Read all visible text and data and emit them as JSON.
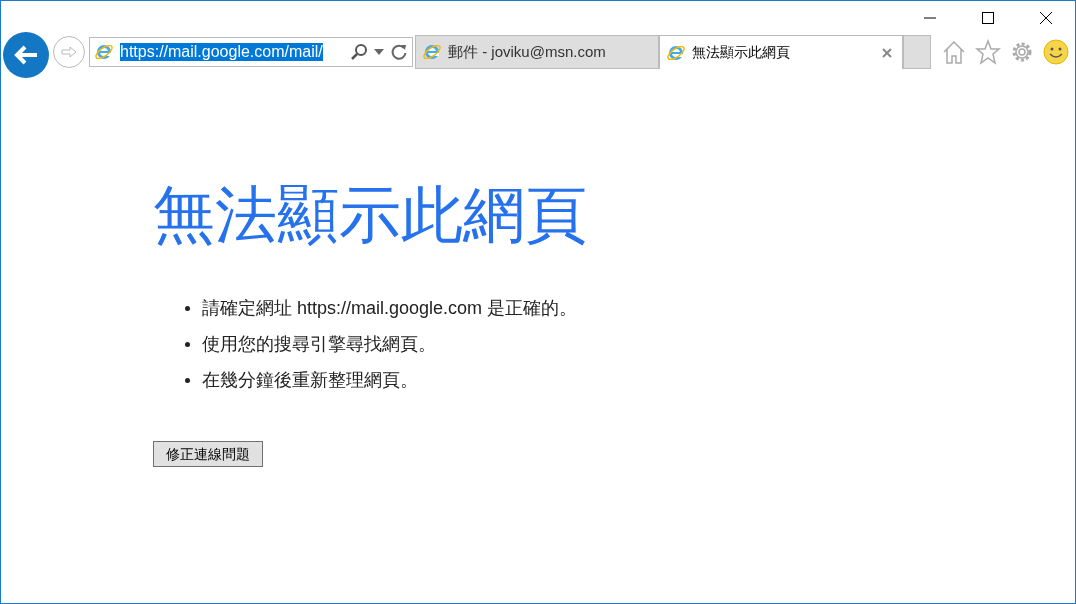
{
  "address_bar": {
    "value": "https://mail.google.com/mail/"
  },
  "tabs": [
    {
      "label": "郵件 - joviku@msn.com",
      "selected": false
    },
    {
      "label": "無法顯示此網頁",
      "selected": true
    }
  ],
  "page": {
    "heading": "無法顯示此網頁",
    "tips": [
      {
        "text": "請確定網址 https://mail.google.com 是正確的。"
      },
      {
        "text": "使用您的搜尋引擎尋找網頁。"
      },
      {
        "text": "在幾分鐘後重新整理網頁。"
      }
    ],
    "button": "修正連線問題"
  }
}
